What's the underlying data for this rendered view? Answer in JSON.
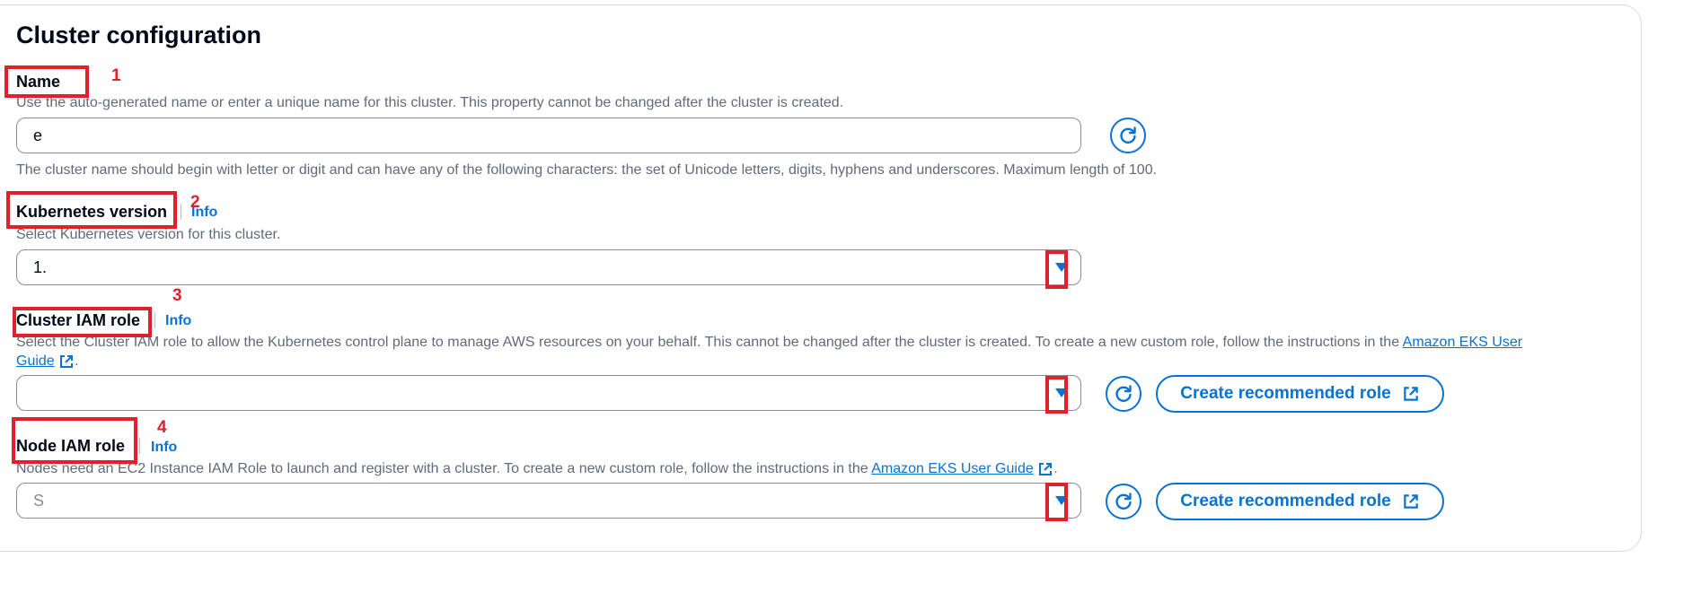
{
  "section": {
    "title": "Cluster configuration"
  },
  "name": {
    "label": "Name",
    "description": "Use the auto-generated name or enter a unique name for this cluster. This property cannot be changed after the cluster is created.",
    "value": "e",
    "constraint": "The cluster name should begin with letter or digit and can have any of the following characters: the set of Unicode letters, digits, hyphens and underscores. Maximum length of 100."
  },
  "k8s_version": {
    "label": "Kubernetes version",
    "info": "Info",
    "description": "Select Kubernetes version for this cluster.",
    "value": "1."
  },
  "cluster_role": {
    "label": "Cluster IAM role",
    "info": "Info",
    "description_prefix": "Select the Cluster IAM role to allow the Kubernetes control plane to manage AWS resources on your behalf. This cannot be changed after the cluster is created. To create a new custom role, follow the instructions in the ",
    "link_part1": "Amazon EKS User",
    "link_part2": "Guide",
    "description_suffix": ".",
    "value": "",
    "create_button": "Create recommended role"
  },
  "node_role": {
    "label": "Node IAM role",
    "info": "Info",
    "description_prefix": "Nodes need an EC2 Instance IAM Role to launch and register with a cluster. To create a new custom role, follow the instructions in the ",
    "link": "Amazon EKS User Guide",
    "description_suffix": ".",
    "value": "S",
    "create_button": "Create recommended role"
  },
  "annotations": {
    "n1": "1",
    "n2": "2",
    "n3": "3",
    "n4": "4"
  },
  "colors": {
    "accent": "#0972d3",
    "annotation_red": "#e0202b",
    "text_secondary": "#5f6b7a"
  }
}
